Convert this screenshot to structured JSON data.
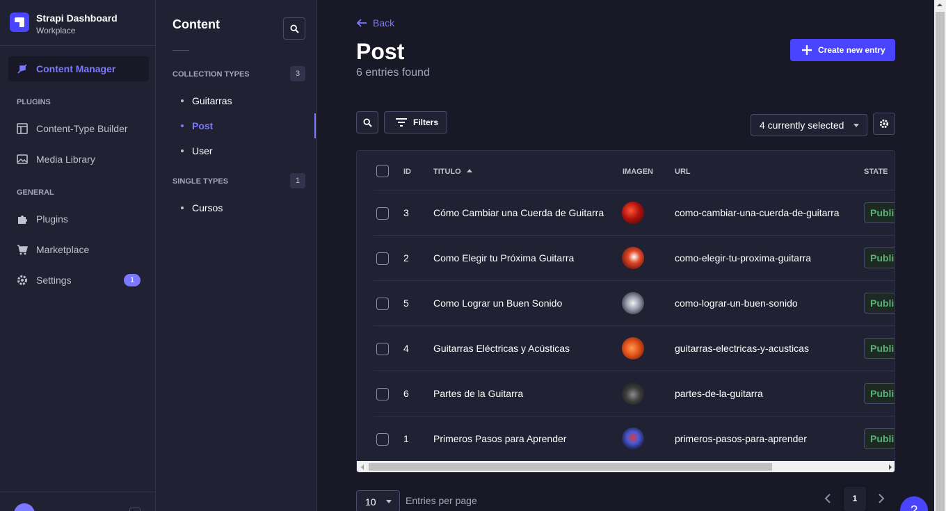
{
  "brand": {
    "title": "Strapi Dashboard",
    "subtitle": "Workplace"
  },
  "mainnav": {
    "content_manager": "Content Manager",
    "plugins_section": "PLUGINS",
    "ctb": "Content-Type Builder",
    "media": "Media Library",
    "general_section": "GENERAL",
    "plugins": "Plugins",
    "marketplace": "Marketplace",
    "settings": "Settings",
    "settings_badge": "1"
  },
  "subnav": {
    "title": "Content",
    "collection_label": "COLLECTION TYPES",
    "collection_count": "3",
    "collection_items": [
      "Guitarras",
      "Post",
      "User"
    ],
    "single_label": "SINGLE TYPES",
    "single_count": "1",
    "single_items": [
      "Cursos"
    ]
  },
  "header": {
    "back": "Back",
    "title": "Post",
    "subtitle": "6 entries found",
    "create": "Create new entry"
  },
  "toolbar": {
    "filters": "Filters",
    "columns_selected": "4 currently selected"
  },
  "table": {
    "headers": {
      "id": "ID",
      "titulo": "TITULO",
      "imagen": "IMAGEN",
      "url": "URL",
      "state": "STATE"
    },
    "rows": [
      {
        "id": "3",
        "titulo": "Cómo Cambiar una Cuerda de Guitarra",
        "url": "como-cambiar-una-cuerda-de-guitarra",
        "state": "Publis"
      },
      {
        "id": "2",
        "titulo": "Como Elegir tu Próxima Guitarra",
        "url": "como-elegir-tu-proxima-guitarra",
        "state": "Publis"
      },
      {
        "id": "5",
        "titulo": "Como Lograr un Buen Sonido",
        "url": "como-lograr-un-buen-sonido",
        "state": "Publis"
      },
      {
        "id": "4",
        "titulo": "Guitarras Eléctricas y Acústicas",
        "url": "guitarras-electricas-y-acusticas",
        "state": "Publis"
      },
      {
        "id": "6",
        "titulo": "Partes de la Guitarra",
        "url": "partes-de-la-guitarra",
        "state": "Publis"
      },
      {
        "id": "1",
        "titulo": "Primeros Pasos para Aprender",
        "url": "primeros-pasos-para-aprender",
        "state": "Publis"
      }
    ]
  },
  "footer": {
    "per_page_value": "10",
    "per_page_label": "Entries per page",
    "current_page": "1",
    "help": "?"
  },
  "colors": {
    "accent": "#4945ff",
    "accent_light": "#7b79ff",
    "bg": "#181826",
    "panel": "#212134",
    "published": "#5cb176"
  }
}
